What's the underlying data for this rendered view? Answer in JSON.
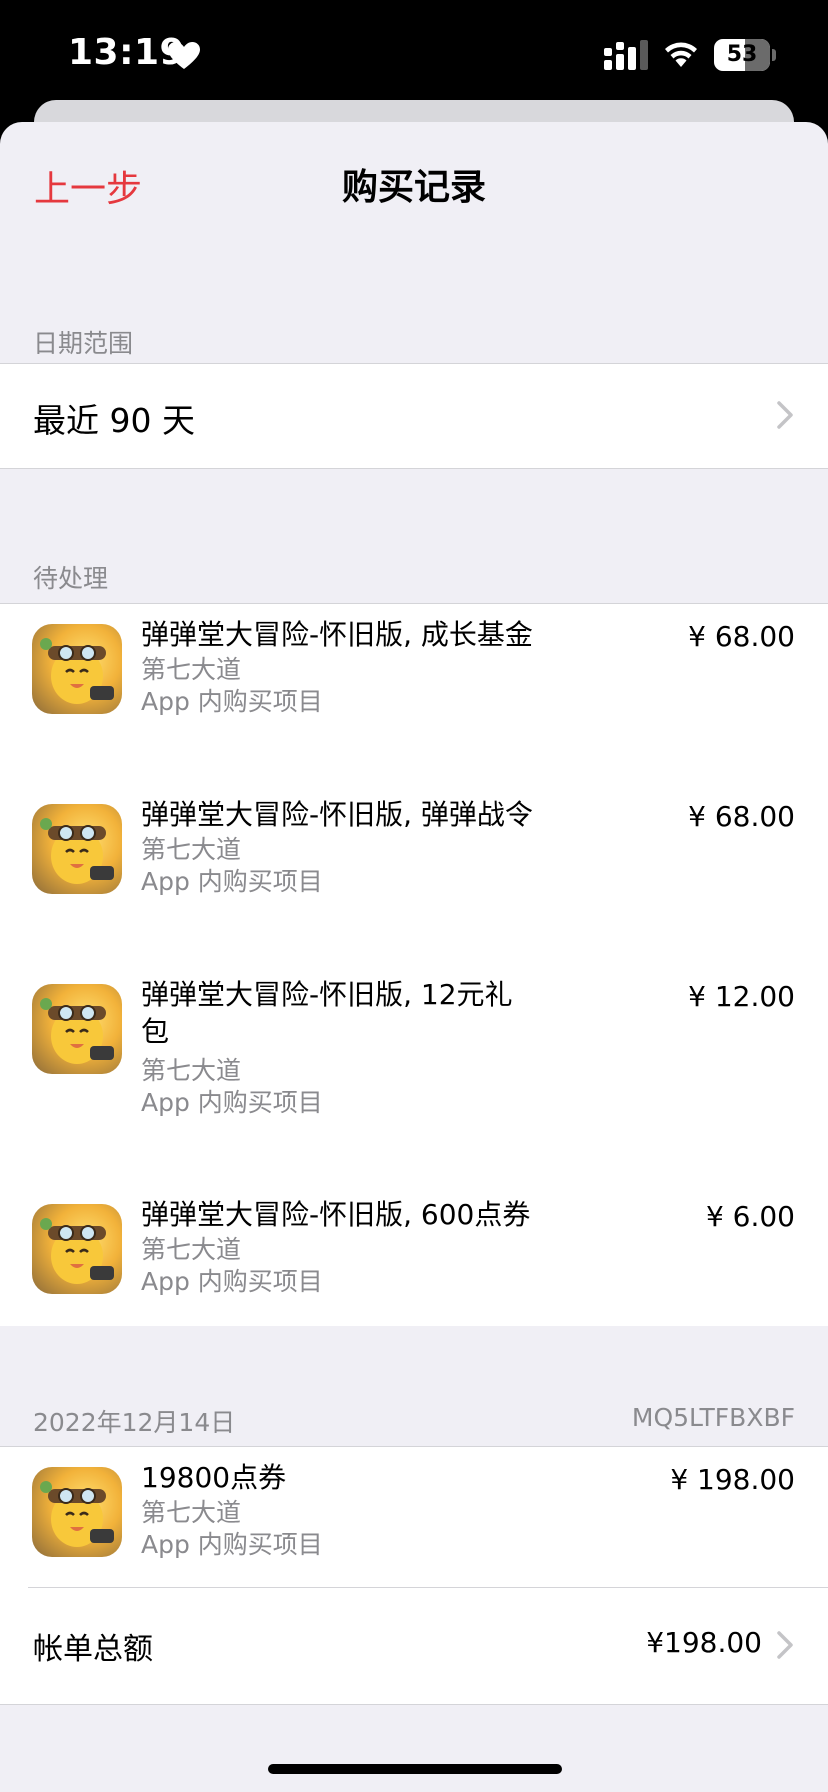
{
  "status": {
    "time": "13:19",
    "battery": "53"
  },
  "nav": {
    "back_label": "上一步",
    "title": "购买记录"
  },
  "date_range": {
    "header": "日期范围",
    "value": "最近 90 天"
  },
  "pending": {
    "header": "待处理",
    "items": [
      {
        "title": "弹弹堂大冒险-怀旧版, 成长基金",
        "developer": "第七大道",
        "type": "App 内购买项目",
        "price": "¥ 68.00"
      },
      {
        "title": "弹弹堂大冒险-怀旧版, 弹弹战令",
        "developer": "第七大道",
        "type": "App 内购买项目",
        "price": "¥ 68.00"
      },
      {
        "title_line1": "弹弹堂大冒险-怀旧版, 12元礼",
        "title_line2": "包",
        "developer": "第七大道",
        "type": "App 内购买项目",
        "price": "¥ 12.00"
      },
      {
        "title": "弹弹堂大冒险-怀旧版, 600点券",
        "developer": "第七大道",
        "type": "App 内购买项目",
        "price": "¥ 6.00"
      }
    ]
  },
  "order": {
    "date": "2022年12月14日",
    "order_id": "MQ5LTFBXBF",
    "items": [
      {
        "title": "19800点券",
        "developer": "第七大道",
        "type": "App 内购买项目",
        "price": "¥ 198.00"
      }
    ],
    "total_label": "帐单总额",
    "total_value": "¥198.00"
  }
}
